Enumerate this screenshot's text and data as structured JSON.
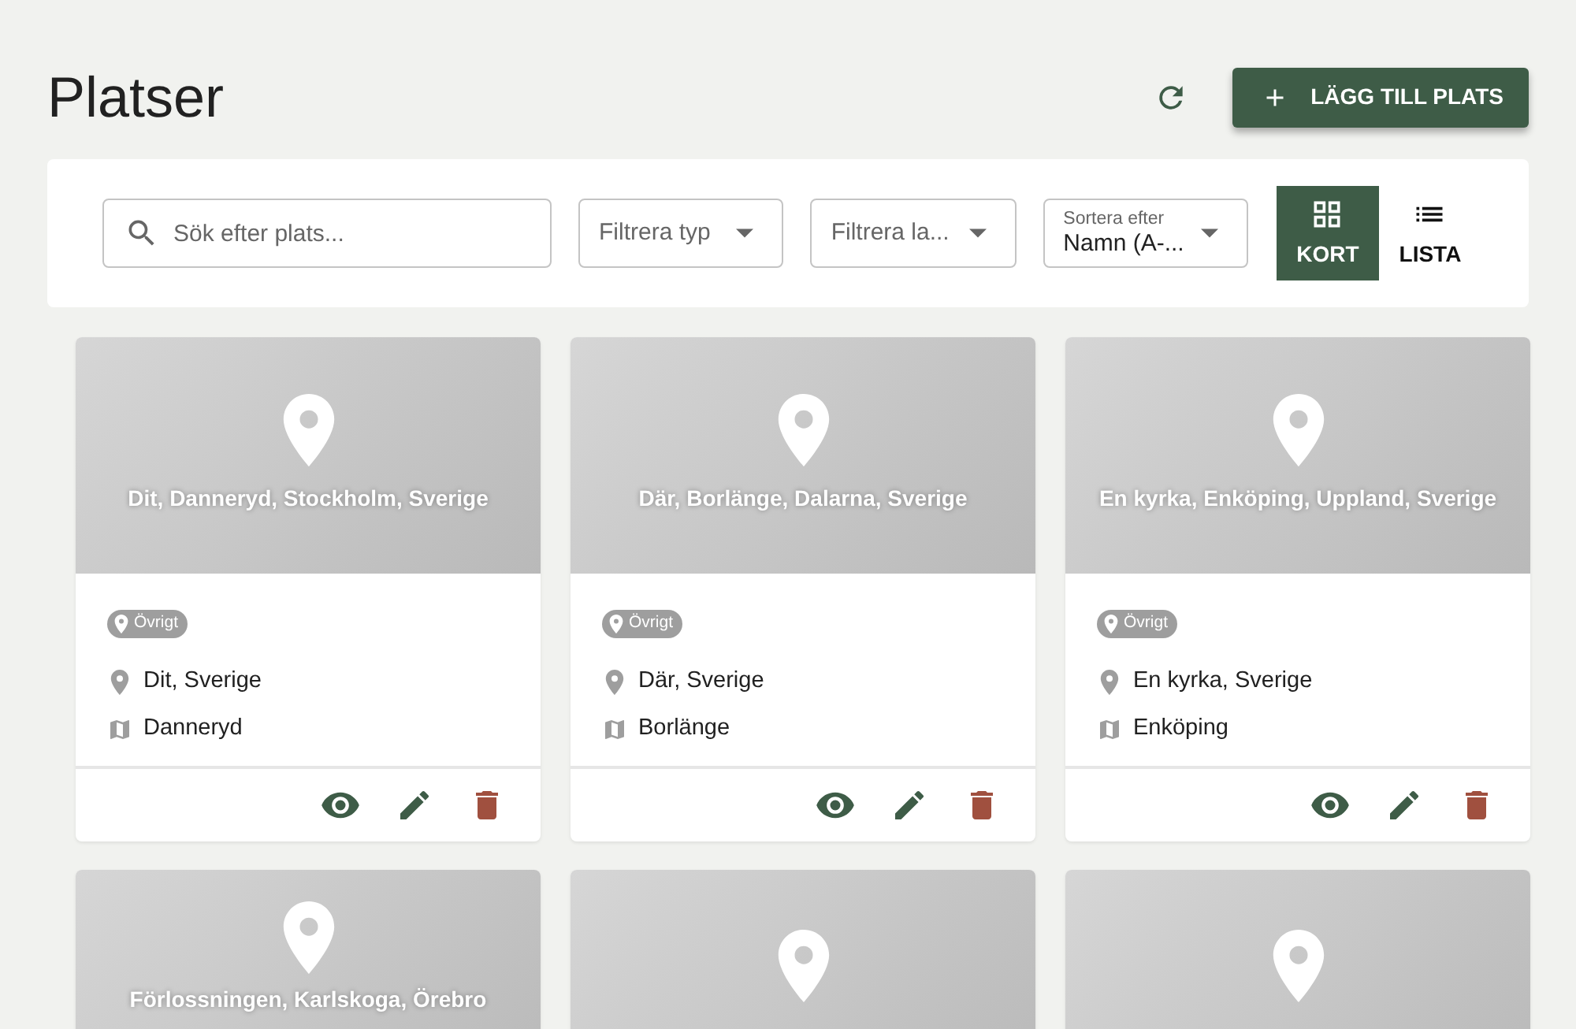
{
  "header": {
    "title": "Platser",
    "add_button": "LÄGG TILL PLATS"
  },
  "toolbar": {
    "search": {
      "placeholder": "Sök efter plats..."
    },
    "filters": [
      {
        "kind": "select",
        "placeholder": "Filtrera typ"
      },
      {
        "kind": "select",
        "placeholder": "Filtrera la..."
      },
      {
        "kind": "labeled",
        "label": "Sortera efter",
        "value": "Namn (A-..."
      }
    ],
    "views": [
      {
        "kind": "grid",
        "label": "KORT",
        "selected": true
      },
      {
        "kind": "list",
        "label": "LISTA",
        "selected": false
      }
    ]
  },
  "places": [
    {
      "kind": "full",
      "title": "Dit, Danneryd, Stockholm, Sverige",
      "tag": "Övrigt",
      "address": "Dit, Sverige",
      "city": "Danneryd"
    },
    {
      "kind": "full",
      "title": "Där, Borlänge, Dalarna, Sverige",
      "tag": "Övrigt",
      "address": "Där, Sverige",
      "city": "Borlänge"
    },
    {
      "kind": "full",
      "title": "En kyrka, Enköping, Uppland, Sverige",
      "tag": "Övrigt",
      "address": "En kyrka, Sverige",
      "city": "Enköping"
    },
    {
      "kind": "partial",
      "title": "Förlossningen, Karlskoga, Örebro"
    },
    {
      "kind": "partial"
    },
    {
      "kind": "partial"
    }
  ]
}
